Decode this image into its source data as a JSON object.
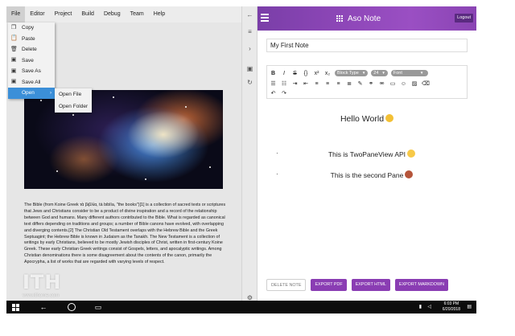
{
  "menubar": {
    "items": [
      "File",
      "Editor",
      "Project",
      "Build",
      "Debug",
      "Team",
      "Help"
    ]
  },
  "file_menu": {
    "items": [
      {
        "label": "Copy",
        "icon": "copy-icon"
      },
      {
        "label": "Paste",
        "icon": "paste-icon"
      },
      {
        "label": "Delete",
        "icon": "delete-icon"
      },
      {
        "label": "Save",
        "icon": "save-icon"
      },
      {
        "label": "Save As",
        "icon": "save-as-icon"
      },
      {
        "label": "Save All",
        "icon": "save-all-icon"
      },
      {
        "label": "Open",
        "icon": "open-icon"
      }
    ],
    "open_submenu": [
      "Open File",
      "Open Folder"
    ]
  },
  "left_pane": {
    "body_text": "The Bible (from Koine Greek τὰ βιβλία, tà biblía, \"the books\")[1] is a collection of sacred texts or scriptures that Jews and Christians consider to be a product of divine inspiration and a record of the relationship between God and humans. Many different authors contributed to the Bible. What is regarded as canonical text differs depending on traditions and groups; a number of Bible canons have evolved, with overlapping and diverging contents.[2] The Christian Old Testament overlaps with the Hebrew Bible and the Greek Septuagint; the Hebrew Bible is known in Judaism as the Tanakh. The New Testament is a collection of writings by early Christians, believed to be mostly Jewish disciples of Christ, written in first-century Koine Greek. These early Christian Greek writings consist of Gospels, letters, and apocalyptic writings. Among Christian denominations there is some disagreement about the contents of the canon, primarily the Apocrypha, a list of works that are regarded with varying levels of respect."
  },
  "watermark": {
    "logo": "ITH",
    "url": "www.ithome.com"
  },
  "app": {
    "title": "Aso Note",
    "logout_label": "Logout",
    "accent": "#8e47b8"
  },
  "note": {
    "title": "My First Note",
    "toolbar": {
      "row1": [
        "B",
        "I",
        "S",
        "{}",
        "x²",
        "x₂"
      ],
      "block_type": "Block Type",
      "font_size": "24",
      "font": "Font"
    },
    "heading": "Hello World",
    "bullets": [
      "This is TwoPaneView API",
      "This is the second Pane"
    ]
  },
  "buttons": {
    "delete": "DELETE NOTE",
    "export_pdf": "EXPORT PDF",
    "export_html": "EXPORT HTML",
    "export_markdown": "EXPORT MARKDOWN"
  },
  "taskbar": {
    "time": "6:03 PM",
    "date": "6/20/2018"
  }
}
